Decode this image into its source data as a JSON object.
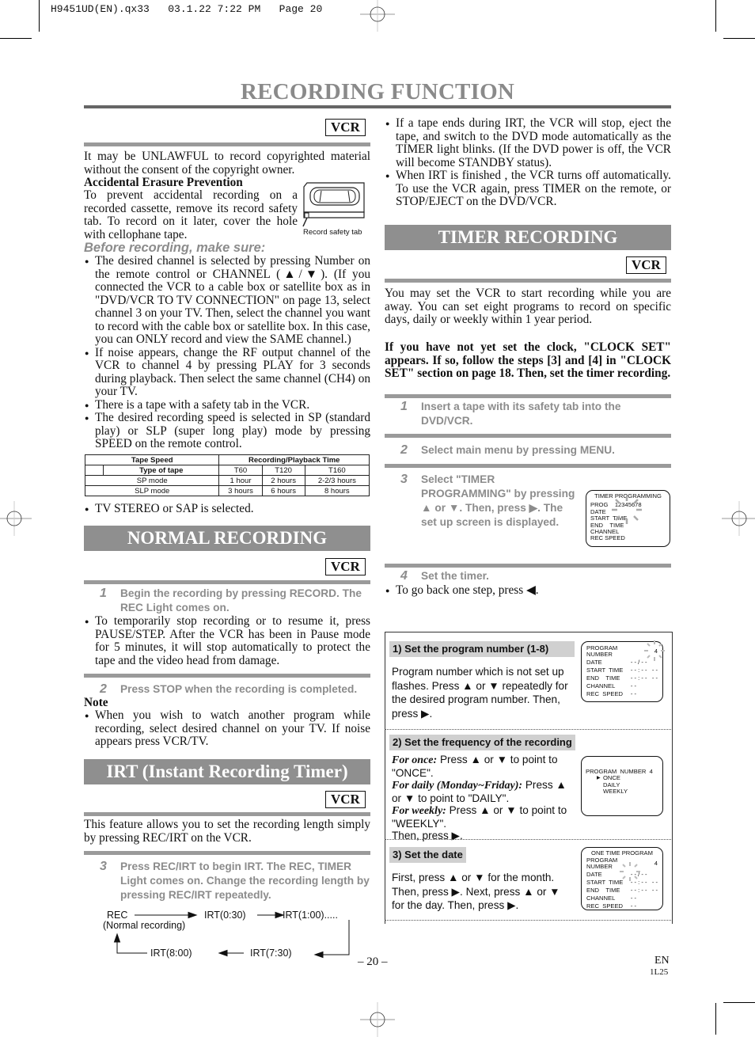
{
  "print_header": "H9451UD(EN).qx33   03.1.22 7:22 PM   Page 20",
  "page_title": "RECORDING FUNCTION",
  "badge": "VCR",
  "left": {
    "intro": "It may be UNLAWFUL to record copyrighted material without the consent of the copyright owner.",
    "erasure_heading": "Accidental Erasure Prevention",
    "erasure_text": "To prevent accidental recording on a recorded cassette, remove its record safety tab. To record on it later, cover the hole with cellophane tape.",
    "cassette_caption": "Record safety tab",
    "before_heading": "Before recording, make sure:",
    "before_bullets": [
      "The desired channel is selected by pressing Number on the remote control or CHANNEL (▲/▼). (If you connected the VCR to a cable box or satellite box as in \"DVD/VCR TO TV CONNECTION\" on page 13, select channel 3 on your TV. Then, select the channel you want to record with the cable box or satellite box. In this case, you can ONLY record and view the SAME channel.)",
      "If noise appears, change the RF output channel of the VCR to channel 4 by pressing PLAY for 3 seconds during playback.  Then select the same channel (CH4) on your TV.",
      "There is a tape with a safety tab in the VCR.",
      "The desired recording speed is selected in SP (standard play) or SLP (super long play) mode by pressing SPEED on the remote control."
    ],
    "table": {
      "header_speed": "Tape Speed",
      "header_time": "Recording/Playback Time",
      "header_type": "Type of tape",
      "tapes": [
        "T60",
        "T120",
        "T160"
      ],
      "rows": [
        {
          "mode": "SP mode",
          "values": [
            "1 hour",
            "2 hours",
            "2-2/3 hours"
          ]
        },
        {
          "mode": "SLP mode",
          "values": [
            "3 hours",
            "6 hours",
            "8 hours"
          ]
        }
      ]
    },
    "after_table_bullet": "TV STEREO or SAP is selected.",
    "normal": {
      "heading": "NORMAL RECORDING",
      "step1_num": "1",
      "step1": "Begin the recording by pressing RECORD. The REC Light comes on.",
      "step1_bullet": "To temporarily stop recording or to resume it, press PAUSE/STEP. After the VCR has been in Pause mode for 5 minutes, it will stop automatically to protect the tape and the video head from damage.",
      "step2_num": "2",
      "step2": "Press STOP when the recording is completed.",
      "note_heading": "Note",
      "note_bullet": "When you wish to watch another program while recording, select desired channel on your TV.  If noise appears press VCR/TV."
    },
    "irt": {
      "heading": "IRT (Instant Recording Timer)",
      "intro": "This feature allows you to set the recording length simply by pressing REC/IRT on the VCR.",
      "step3_num": "3",
      "step3": "Press REC/IRT to begin IRT. The REC, TIMER Light comes on. Change the recording length by pressing REC/IRT repeatedly.",
      "flow": {
        "rec": "REC",
        "rec_sub": "(Normal recording)",
        "irt030": "IRT(0:30)",
        "irt100": "IRT(1:00).....",
        "irt730": "IRT(7:30)",
        "irt800": "IRT(8:00)"
      }
    }
  },
  "right": {
    "irt_bullets": [
      "If a tape ends during IRT, the VCR will stop, eject the tape, and switch to the DVD mode automatically as the TIMER light blinks. (If the DVD power is off, the VCR will become STANDBY status).",
      "When IRT is finished , the VCR turns off automatically. To use the VCR again, press TIMER on the remote, or STOP/EJECT on the DVD/VCR."
    ],
    "timer": {
      "heading": "TIMER RECORDING",
      "intro": "You may set the VCR to start recording while you are away. You can set eight programs to record on specific days, daily or weekly within 1 year period.",
      "clock_note": "If you have not yet set the clock, \"CLOCK SET\" appears. If so, follow the steps [3] and [4] in \"CLOCK SET\" section on page 18. Then, set the timer recording.",
      "steps": [
        {
          "num": "1",
          "text": "Insert a tape with its safety tab into the DVD/VCR."
        },
        {
          "num": "2",
          "text": "Select main menu by pressing MENU."
        },
        {
          "num": "3",
          "text": "Select \"TIMER PROGRAMMING\" by pressing ▲ or ▼. Then, press ▶. The set up screen is displayed."
        },
        {
          "num": "4",
          "text": "Set the timer."
        }
      ],
      "step4_bullet": "To go back one step, press ◀.",
      "osd_timer_prog": {
        "title": "TIMER PROGRAMMING",
        "prog_label": "PROG",
        "prog_value": "12345678",
        "lines": [
          "DATE",
          "START  TIME",
          "END    TIME",
          "CHANNEL",
          "REC  SPEED"
        ]
      },
      "substeps": [
        {
          "heading": "1) Set the program number (1-8)",
          "text": "Program number which is not set up flashes. Press ▲ or ▼ repeatedly for the desired program number. Then, press ▶.",
          "osd": {
            "rows": [
              [
                "PROGRAM NUMBER",
                "4"
              ],
              [
                "DATE",
                "- - / - -"
              ],
              [
                "START  TIME",
                "- - : - -   - -"
              ],
              [
                "END    TIME",
                "- - : - -   - -"
              ],
              [
                "CHANNEL",
                "- -"
              ],
              [
                "REC  SPEED",
                "- -"
              ]
            ]
          }
        },
        {
          "heading": "2) Set the frequency of the recording",
          "once_label": "For once:",
          "once_text": " Press ▲ or ▼ to point to \"ONCE\".",
          "daily_label": "For daily (Monday~Friday):",
          "daily_text": " Press ▲ or ▼ to point to \"DAILY\".",
          "weekly_label": "For weekly:",
          "weekly_text": " Press ▲ or ▼ to point to \"WEEKLY\".",
          "then": "Then, press ▶.",
          "osd": {
            "title": "PROGRAM  NUMBER  4",
            "options": [
              "ONCE",
              "DAILY",
              "WEEKLY"
            ],
            "selected": "ONCE"
          }
        },
        {
          "heading": "3) Set the date",
          "text": "First, press ▲ or ▼ for the month. Then, press ▶. Next, press ▲ or ▼ for the day. Then, press ▶.",
          "osd": {
            "title": "ONE TIME PROGRAM",
            "rows": [
              [
                "PROGRAM NUMBER",
                "4"
              ],
              [
                "DATE",
                "- - / - -"
              ],
              [
                "START  TIME",
                "- - : - -   - -"
              ],
              [
                "END    TIME",
                "- - : - -   - -"
              ],
              [
                "CHANNEL",
                "- -"
              ],
              [
                "REC  SPEED",
                "- -"
              ]
            ]
          }
        }
      ]
    }
  },
  "footer": {
    "page_number": "– 20 –",
    "lang": "EN",
    "code": "1L25"
  }
}
